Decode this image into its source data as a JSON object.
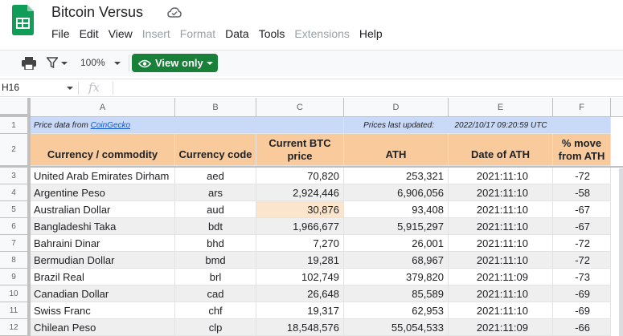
{
  "app": {
    "title": "Bitcoin Versus",
    "menu": [
      {
        "label": "File",
        "disabled": false
      },
      {
        "label": "Edit",
        "disabled": false
      },
      {
        "label": "View",
        "disabled": false
      },
      {
        "label": "Insert",
        "disabled": true
      },
      {
        "label": "Format",
        "disabled": true
      },
      {
        "label": "Data",
        "disabled": false
      },
      {
        "label": "Tools",
        "disabled": false
      },
      {
        "label": "Extensions",
        "disabled": true
      },
      {
        "label": "Help",
        "disabled": false
      }
    ]
  },
  "toolbar": {
    "zoom": "100%",
    "view_only_label": "View only",
    "accent": "#188038"
  },
  "formula_bar": {
    "name_box": "H16",
    "fx": "fx",
    "formula": ""
  },
  "sheet": {
    "columns": [
      "A",
      "B",
      "C",
      "D",
      "E",
      "F"
    ],
    "row1": {
      "row_num": "1",
      "source_prefix": "Price data from",
      "source_link": "CoinGecko",
      "updated_label": "Prices last updated:",
      "updated_value": "2022/10/17 09:20:59 UTC"
    },
    "row2": {
      "row_num": "2",
      "headers": [
        "Currency / commodity",
        "Currency code",
        "Current BTC price",
        "ATH",
        "Date of ATH",
        "% move from ATH"
      ]
    },
    "rows": [
      {
        "num": "3",
        "name": "United Arab Emirates Dirham",
        "code": "aed",
        "price": "70,820",
        "ath": "253,321",
        "date": "2021:11:10",
        "move": "-72"
      },
      {
        "num": "4",
        "name": "Argentine Peso",
        "code": "ars",
        "price": "2,924,446",
        "ath": "6,906,056",
        "date": "2021:11:10",
        "move": "-58"
      },
      {
        "num": "5",
        "name": "Australian Dollar",
        "code": "aud",
        "price": "30,876",
        "ath": "93,408",
        "date": "2021:11:10",
        "move": "-67"
      },
      {
        "num": "6",
        "name": "Bangladeshi Taka",
        "code": "bdt",
        "price": "1,966,677",
        "ath": "5,915,297",
        "date": "2021:11:10",
        "move": "-67"
      },
      {
        "num": "7",
        "name": "Bahraini Dinar",
        "code": "bhd",
        "price": "7,270",
        "ath": "26,001",
        "date": "2021:11:10",
        "move": "-72"
      },
      {
        "num": "8",
        "name": "Bermudian Dollar",
        "code": "bmd",
        "price": "19,281",
        "ath": "68,967",
        "date": "2021:11:10",
        "move": "-72"
      },
      {
        "num": "9",
        "name": "Brazil Real",
        "code": "brl",
        "price": "102,749",
        "ath": "379,820",
        "date": "2021:11:09",
        "move": "-73"
      },
      {
        "num": "10",
        "name": "Canadian Dollar",
        "code": "cad",
        "price": "26,648",
        "ath": "85,589",
        "date": "2021:11:10",
        "move": "-69"
      },
      {
        "num": "11",
        "name": "Swiss Franc",
        "code": "chf",
        "price": "19,317",
        "ath": "62,953",
        "date": "2021:11:10",
        "move": "-69"
      },
      {
        "num": "12",
        "name": "Chilean Peso",
        "code": "clp",
        "price": "18,548,576",
        "ath": "55,054,533",
        "date": "2021:11:09",
        "move": "-66"
      }
    ],
    "colors": {
      "info_row": "#c9daf8",
      "header_row": "#f9cb9c",
      "highlight_cell": "#fce5cd",
      "banded_row": "#efefef",
      "link": "#1155cc"
    }
  }
}
